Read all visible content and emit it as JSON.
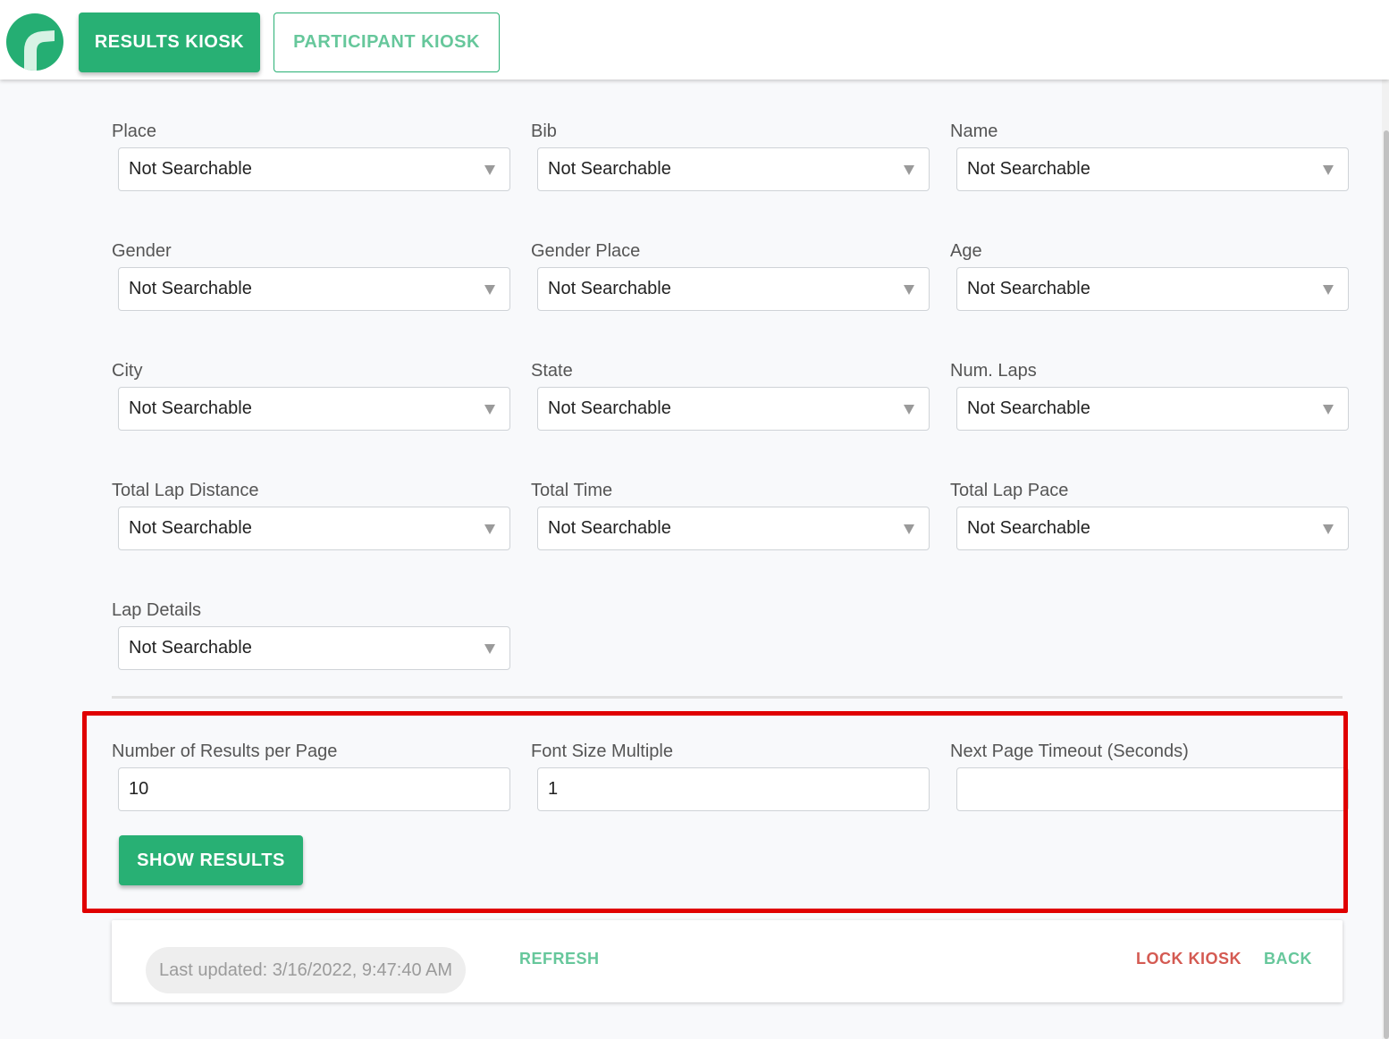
{
  "header": {
    "logo_icon": "reload-logo-icon",
    "tabs": [
      {
        "label": "RESULTS KIOSK",
        "active": true
      },
      {
        "label": "PARTICIPANT KIOSK",
        "active": false
      }
    ]
  },
  "fields": [
    {
      "label": "Place",
      "value": "Not Searchable"
    },
    {
      "label": "Bib",
      "value": "Not Searchable"
    },
    {
      "label": "Name",
      "value": "Not Searchable"
    },
    {
      "label": "Gender",
      "value": "Not Searchable"
    },
    {
      "label": "Gender Place",
      "value": "Not Searchable"
    },
    {
      "label": "Age",
      "value": "Not Searchable"
    },
    {
      "label": "City",
      "value": "Not Searchable"
    },
    {
      "label": "State",
      "value": "Not Searchable"
    },
    {
      "label": "Num. Laps",
      "value": "Not Searchable"
    },
    {
      "label": "Total Lap Distance",
      "value": "Not Searchable"
    },
    {
      "label": "Total Time",
      "value": "Not Searchable"
    },
    {
      "label": "Total Lap Pace",
      "value": "Not Searchable"
    },
    {
      "label": "Lap Details",
      "value": "Not Searchable"
    }
  ],
  "settings": {
    "results_per_page": {
      "label": "Number of Results per Page",
      "value": "10"
    },
    "font_size_multiple": {
      "label": "Font Size Multiple",
      "value": "1"
    },
    "next_page_timeout": {
      "label": "Next Page Timeout (Seconds)",
      "value": ""
    },
    "show_results_label": "SHOW RESULTS"
  },
  "footer": {
    "last_updated": "Last updated: 3/16/2022, 9:47:40 AM",
    "refresh_label": "REFRESH",
    "lock_label": "LOCK KIOSK",
    "back_label": "BACK"
  },
  "colors": {
    "accent": "#28b074",
    "highlight": "#e00000",
    "danger": "#d45a52"
  }
}
